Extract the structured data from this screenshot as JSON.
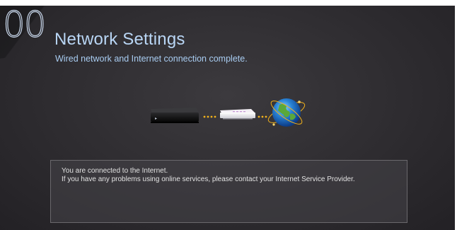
{
  "step": {
    "number": "00"
  },
  "header": {
    "title": "Network Settings",
    "subtitle": "Wired network and Internet connection complete."
  },
  "diagram": {
    "icons": [
      "tv-device-icon",
      "router-icon",
      "globe-icon"
    ],
    "connection_color": "#f2b21c"
  },
  "info": {
    "line1": "You are connected to the Internet.",
    "line2": "If you have any problems using online services, please contact your Internet Service Provider."
  },
  "colors": {
    "title": "#b9d6f5",
    "background": "#2e2c30"
  }
}
